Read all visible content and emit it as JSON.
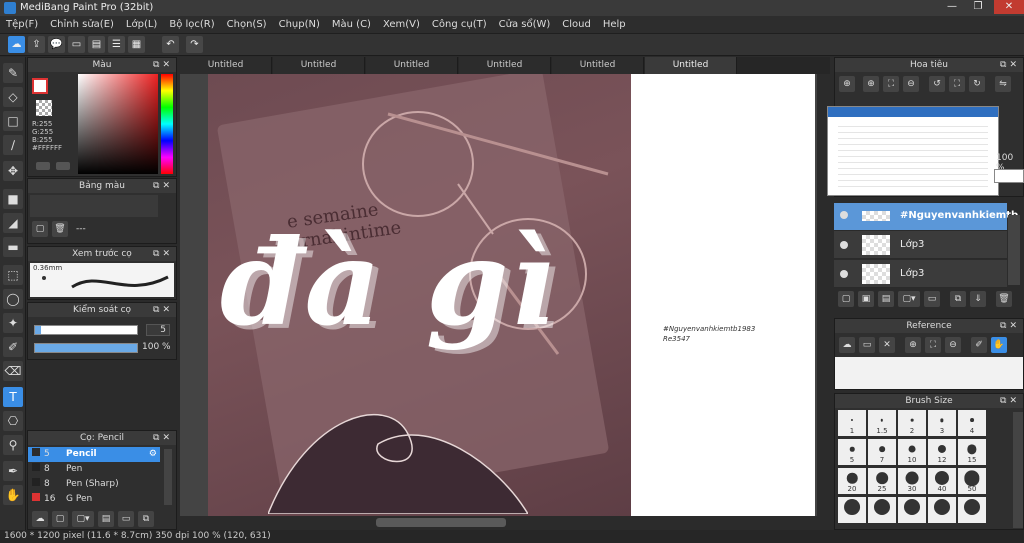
{
  "window": {
    "title": "MediBang Paint Pro (32bit)",
    "minimize": "—",
    "restore": "❐",
    "close": "✕"
  },
  "menu": [
    "Tệp(F)",
    "Chỉnh sửa(E)",
    "Lớp(L)",
    "Bộ lọc(R)",
    "Chọn(S)",
    "Chụp(N)",
    "Màu (C)",
    "Xem(V)",
    "Công cụ(T)",
    "Cửa sổ(W)",
    "Cloud",
    "Help"
  ],
  "tabs": [
    "Untitled",
    "Untitled",
    "Untitled",
    "Untitled",
    "Untitled",
    "Untitled"
  ],
  "color_panel": {
    "title": "Màu",
    "r": "R:255",
    "g": "G:255",
    "b": "B:255",
    "hex": "#FFFFFF"
  },
  "palette_panel": {
    "title": "Bảng màu",
    "value": "---"
  },
  "brush_preview": {
    "title": "Xem trước cọ",
    "size": "0.36mm"
  },
  "brush_control": {
    "title": "Kiểm soát cọ",
    "size_value": "5",
    "opacity_value": "100 %"
  },
  "brush_list": {
    "title": "Cọ: Pencil",
    "items": [
      {
        "size": "5",
        "name": "Pencil"
      },
      {
        "size": "8",
        "name": "Pen"
      },
      {
        "size": "8",
        "name": "Pen (Sharp)"
      },
      {
        "size": "16",
        "name": "G Pen"
      }
    ]
  },
  "canvas": {
    "overlay_text": "đà gì",
    "note_line1": "#Nguyenvanhkiemtb1983",
    "note_line2": "Re3547",
    "book_text1": "e semaine",
    "book_text2": "urnal intime"
  },
  "navigator": {
    "title": "Hoa tiêu"
  },
  "layers": {
    "zoom": "100 %",
    "items": [
      {
        "name": "#Nguyenvanhkiemtb"
      },
      {
        "name": "Lớp3"
      },
      {
        "name": "Lớp3"
      }
    ]
  },
  "reference": {
    "title": "Reference"
  },
  "brush_size": {
    "title": "Brush Size",
    "sizes": [
      "1",
      "1.5",
      "2",
      "3",
      "4",
      "5",
      "7",
      "10",
      "12",
      "15",
      "20",
      "25",
      "30",
      "40",
      "50",
      "",
      "",
      "",
      "",
      ""
    ]
  },
  "status": "1600 * 1200 pixel   (11.6 * 8.7cm)   350 dpi   100 %   (120, 631)",
  "colors": {
    "accent": "#3a8ee6",
    "bg": "#2b2b2b",
    "panel": "#2f2f2f",
    "canvas_photo": "#6e4b52"
  }
}
